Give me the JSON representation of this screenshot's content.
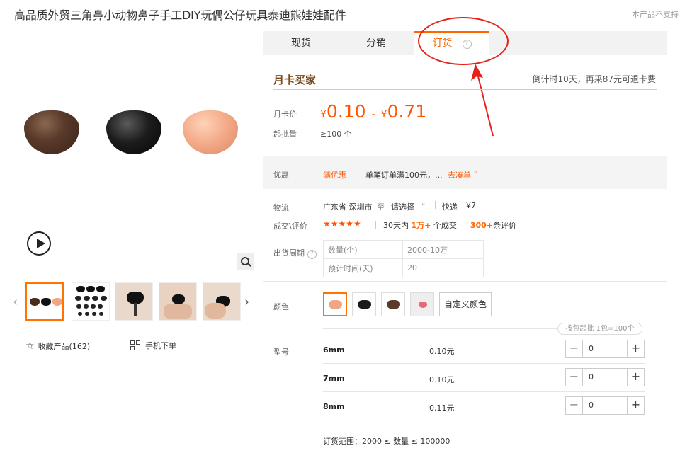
{
  "product": {
    "title": "高品质外贸三角鼻小动物鼻子手工DIY玩偶公仔玩具泰迪熊娃娃配件",
    "unsupported_note": "本产品不支持"
  },
  "gallery": {
    "thumb_count": 5,
    "prev_glyph": "‹",
    "next_glyph": "›",
    "favorite_label": "收藏产品(162)",
    "mobile_order_label": "手机下单"
  },
  "tabs": [
    {
      "label": "现货"
    },
    {
      "label": "分销"
    },
    {
      "label": "订货",
      "active": true,
      "help": "?"
    }
  ],
  "member": {
    "title": "月卡买家",
    "countdown": "倒计时10天，再采87元可退卡费",
    "price_label": "月卡价",
    "currency": "¥",
    "price_min": "0.10",
    "price_max": "0.71",
    "price_sep": "-",
    "moq_label": "起批量",
    "moq_value": "≥100 个"
  },
  "promo": {
    "label": "优惠",
    "tag": "满优惠",
    "text": "单笔订单满100元，...",
    "link": "去凑单 ˅"
  },
  "logistics": {
    "label": "物流",
    "origin": "广东省 深圳市",
    "to": "至",
    "destination": "请选择",
    "method": "快递",
    "fee": "¥7"
  },
  "deals": {
    "label": "成交\\评价",
    "stars": "★★★★★",
    "rating": 5,
    "sales_prefix": "30天内",
    "sales_count": "1万+",
    "sales_suffix": "个成交",
    "reviews_count": "300+",
    "reviews_suffix": "条评价"
  },
  "shipping": {
    "label": "出货周期",
    "help": "?",
    "rows": [
      {
        "k": "数量(个)",
        "v": "2000-10万"
      },
      {
        "k": "预计时间(天)",
        "v": "20"
      }
    ]
  },
  "color": {
    "label": "颜色",
    "swatches": [
      {
        "name": "peach",
        "hex": "#f0a584",
        "active": true
      },
      {
        "name": "black",
        "hex": "#1a1a1a"
      },
      {
        "name": "brown",
        "hex": "#5a3a28"
      },
      {
        "name": "pink",
        "hex": "#e86a7a"
      }
    ],
    "custom_label": "自定义颜色"
  },
  "model": {
    "label": "型号",
    "batch_note": "按包起批 1包=100个",
    "rows": [
      {
        "size": "6mm",
        "price": "0.10元",
        "qty": "0"
      },
      {
        "size": "7mm",
        "price": "0.10元",
        "qty": "0"
      },
      {
        "size": "8mm",
        "price": "0.11元",
        "qty": "0"
      }
    ],
    "order_range": "订货范围：2000 ≤ 数量 ≤ 100000"
  },
  "colors": {
    "accent": "#ff6600",
    "annotation_red": "#e8201a"
  }
}
